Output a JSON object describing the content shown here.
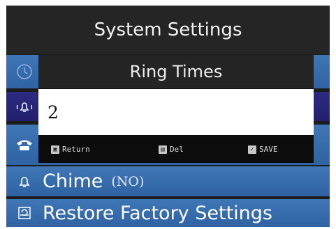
{
  "screen": {
    "title": "System Settings"
  },
  "menu": {
    "items": [
      {
        "id": "time",
        "icon": "clock-icon",
        "label": ""
      },
      {
        "id": "ring",
        "icon": "bell-ring-icon",
        "label": ""
      },
      {
        "id": "phone",
        "icon": "phone-icon",
        "label": ""
      },
      {
        "id": "chime",
        "icon": "bell-icon",
        "label": "Chime",
        "value": "(NO)"
      },
      {
        "id": "restore",
        "icon": "restore-icon",
        "label": "Restore Factory Settings"
      }
    ]
  },
  "dialog": {
    "title": "Ring Times",
    "value": "2",
    "hints": {
      "return_label": "Return",
      "del_label": "Del",
      "save_label": "SAVE"
    }
  },
  "colors": {
    "menu_blue": "#3a6fb0",
    "menu_selected": "#26237a",
    "title_bg": "#252525",
    "dialog_bg": "#0c0c0c"
  }
}
